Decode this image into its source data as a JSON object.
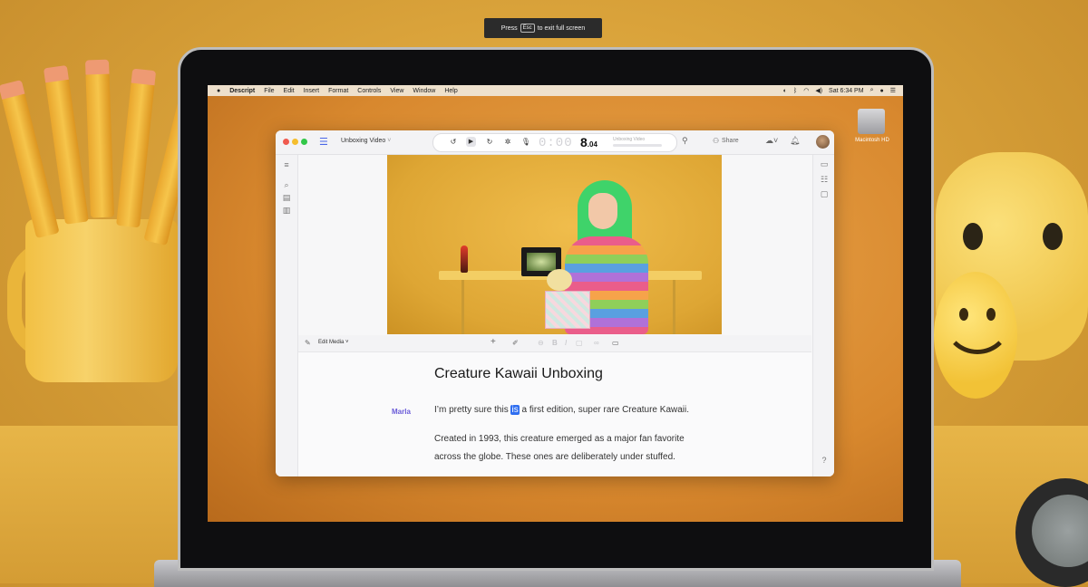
{
  "fullscreen_tip": {
    "press": "Press",
    "key": "Esc",
    "rest": "to exit full screen"
  },
  "menubar": {
    "apple": "",
    "app_name": "Descript",
    "items": [
      "File",
      "Edit",
      "Insert",
      "Format",
      "Controls",
      "View",
      "Window",
      "Help"
    ],
    "clock": "Sat 6:34 PM"
  },
  "desktop": {
    "drive_label": "Macintosh HD"
  },
  "app": {
    "project_name": "Unboxing Video",
    "timer_dim": "0:00",
    "timer_main": "8",
    "timer_frac": ".04",
    "transport_title": "Unboxing Video",
    "share_label": "Share",
    "edit_media_label": "Edit Media",
    "document": {
      "title": "Creature Kawaii Unboxing",
      "speaker": "Marla",
      "line1_before": "I’m pretty sure this ",
      "line1_highlight": "is",
      "line1_after": " a first edition, super rare Creature Kawaii.",
      "line2": "Created in 1993, this creature emerged as a major fan favorite",
      "line3": "across the globe. These ones are deliberately under stuffed."
    }
  },
  "colors": {
    "accent": "#4a66e8",
    "speaker": "#6a5bd8",
    "highlight": "#2f6ef0",
    "close_dot": "#f05a4f",
    "min_dot": "#f5be2e",
    "max_dot": "#32c748"
  },
  "icons": [
    "apple-logo-icon",
    "descript-logo-icon",
    "rewind-icon",
    "play-icon",
    "forward-icon",
    "gear-icon",
    "mic-icon",
    "presenter-icon",
    "share-icon",
    "cloud-icon",
    "bell-icon",
    "menu-icon",
    "search-icon",
    "library-icon",
    "books-icon",
    "layout-icon",
    "sliders-icon",
    "comment-icon",
    "help-icon",
    "pen-icon",
    "plus-icon",
    "brush-icon",
    "strikethrough-icon",
    "bold-icon",
    "italic-icon",
    "image-icon",
    "link-icon"
  ]
}
